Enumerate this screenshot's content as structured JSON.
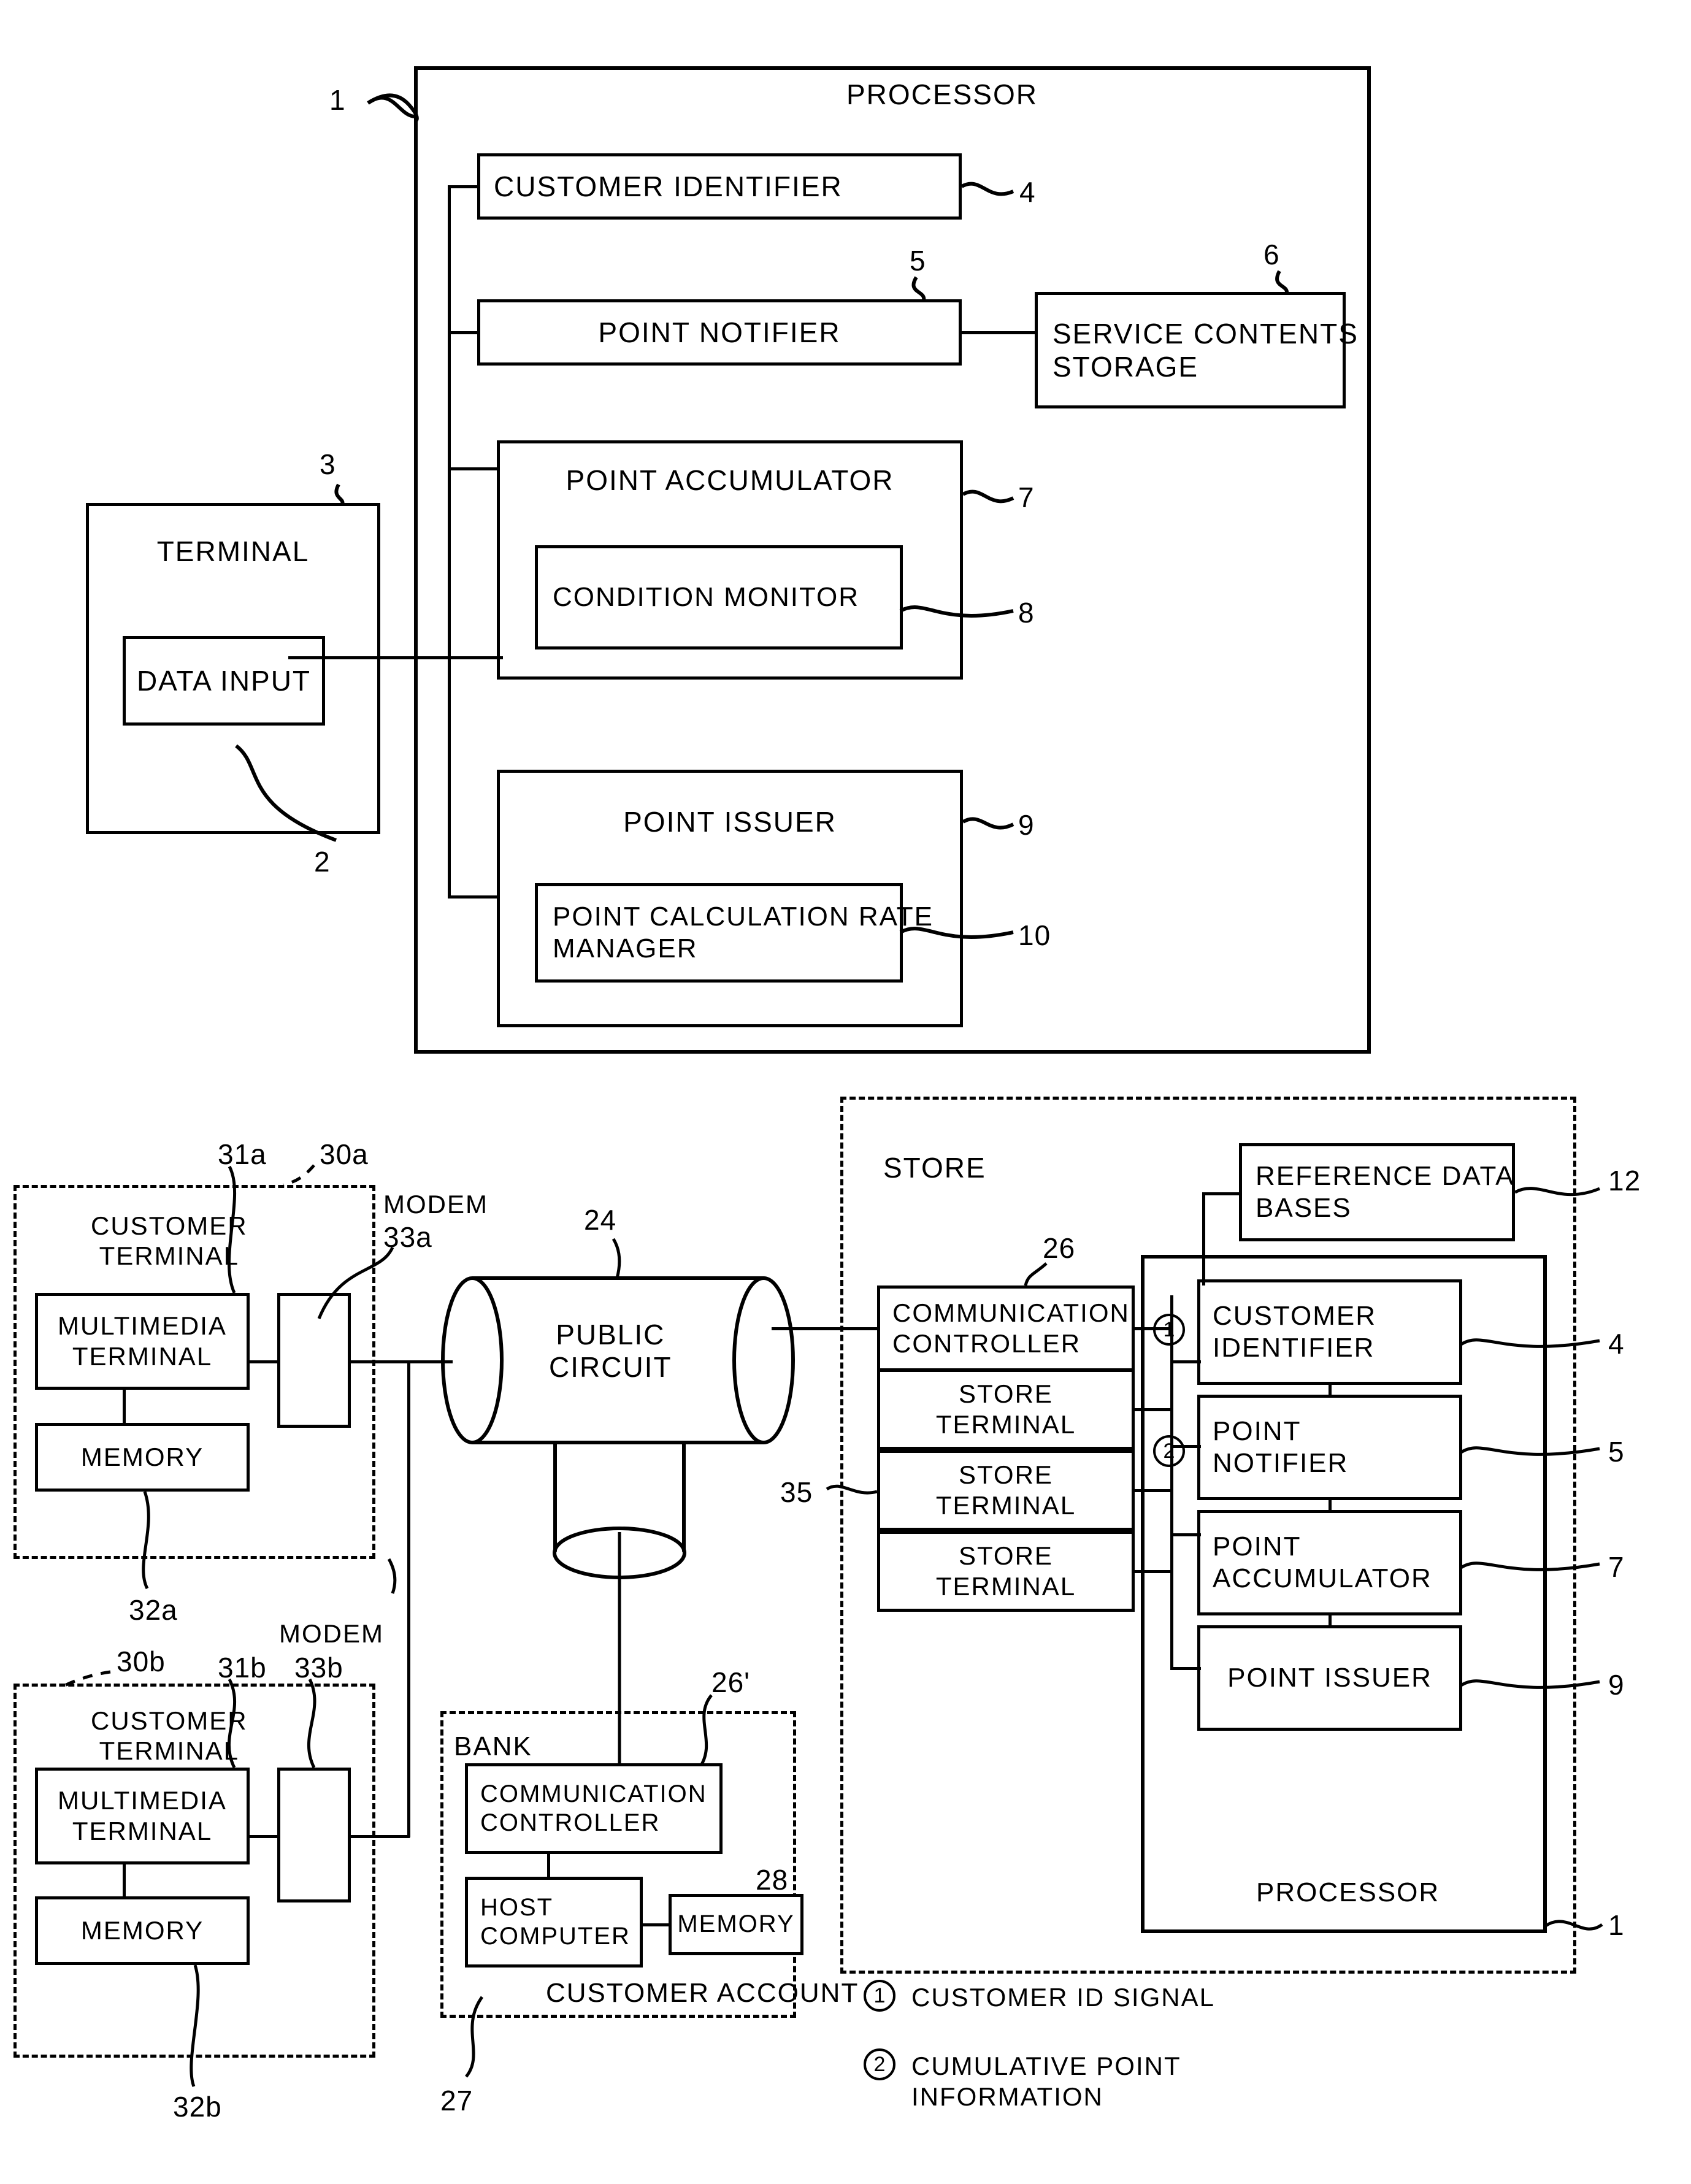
{
  "figure": {
    "top_diagram": {
      "processor_label": "PROCESSOR",
      "processor_ref": "1",
      "terminal": {
        "title": "TERMINAL",
        "ref": "3",
        "data_input": {
          "label": "DATA INPUT",
          "ref": "2"
        }
      },
      "blocks": [
        {
          "label": "CUSTOMER IDENTIFIER",
          "ref": "4"
        },
        {
          "label": "POINT NOTIFIER",
          "ref": "5"
        },
        {
          "label": "SERVICE CONTENTS\nSTORAGE",
          "ref": "6"
        },
        {
          "label": "POINT ACCUMULATOR",
          "ref": "7"
        },
        {
          "label": "CONDITION MONITOR",
          "ref": "8"
        },
        {
          "label": "POINT ISSUER",
          "ref": "9"
        },
        {
          "label": "POINT CALCULATION RATE\nMANAGER",
          "ref": "10"
        }
      ]
    },
    "bottom_diagram": {
      "customer_terminal_a": {
        "group_ref": "30a",
        "title": "CUSTOMER\nTERMINAL",
        "multimedia": {
          "label": "MULTIMEDIA\nTERMINAL",
          "ref": "31a"
        },
        "memory": {
          "label": "MEMORY",
          "ref": "32a"
        },
        "modem": {
          "label": "MODEM",
          "ref": "33a"
        }
      },
      "customer_terminal_b": {
        "group_ref": "30b",
        "title": "CUSTOMER\nTERMINAL",
        "multimedia": {
          "label": "MULTIMEDIA\nTERMINAL",
          "ref": "31b"
        },
        "memory": {
          "label": "MEMORY",
          "ref": "32b"
        },
        "modem": {
          "label": "MODEM",
          "ref": "33b"
        }
      },
      "public_circuit": {
        "label": "PUBLIC\nCIRCUIT",
        "ref": "24"
      },
      "bank": {
        "title": "BANK",
        "customer_account_label": "CUSTOMER ACCOUNT",
        "communication_controller": {
          "label": "COMMUNICATION\nCONTROLLER",
          "ref": "26'"
        },
        "host_computer": {
          "label": "HOST\nCOMPUTER",
          "ref": "27"
        },
        "memory": {
          "label": "MEMORY",
          "ref": "28"
        }
      },
      "store": {
        "title": "STORE",
        "communication_controller": {
          "label": "COMMUNICATION\nCONTROLLER",
          "ref": "26"
        },
        "store_terminals_ref": "35",
        "store_terminals": [
          {
            "label": "STORE\nTERMINAL"
          },
          {
            "label": "STORE\nTERMINAL"
          },
          {
            "label": "STORE\nTERMINAL"
          }
        ],
        "reference_data_bases": {
          "label": "REFERENCE DATA\nBASES",
          "ref": "12"
        },
        "processor_label": "PROCESSOR",
        "processor_ref": "1",
        "processor_blocks": [
          {
            "label": "CUSTOMER\nIDENTIFIER",
            "ref": "4",
            "signal": "1"
          },
          {
            "label": "POINT\nNOTIFIER",
            "ref": "5",
            "signal": "2"
          },
          {
            "label": "POINT\nACCUMULATOR",
            "ref": "7",
            "signal": ""
          },
          {
            "label": "POINT ISSUER",
            "ref": "9",
            "signal": ""
          }
        ]
      },
      "legend": [
        {
          "marker": "1",
          "text": "CUSTOMER ID SIGNAL"
        },
        {
          "marker": "2",
          "text": "CUMULATIVE POINT\nINFORMATION"
        }
      ]
    }
  }
}
